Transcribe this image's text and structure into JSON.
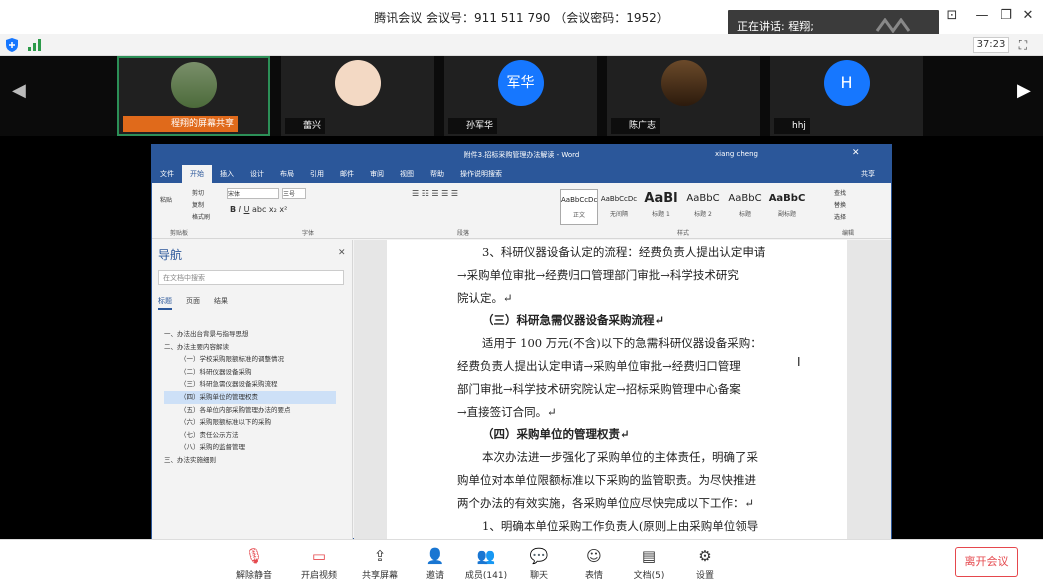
{
  "meeting": {
    "title": "腾讯会议 会议号：911 511 790 （会议密码：1952）",
    "timer": "37:23",
    "speaking": "正在讲话: 程翔;"
  },
  "participants": [
    {
      "name": "程翔的屏幕共享",
      "active": true
    },
    {
      "name": "蕾兴"
    },
    {
      "name": "孙军华",
      "initials": "军华",
      "color": "#1677ff"
    },
    {
      "name": "陈广志"
    },
    {
      "name": "hhj",
      "initials": "H",
      "color": "#1677ff"
    }
  ],
  "word": {
    "title": "附件3.招标采购管理办法解读 - Word",
    "user": "xiang cheng",
    "tabs": [
      "文件",
      "开始",
      "插入",
      "设计",
      "布局",
      "引用",
      "邮件",
      "审阅",
      "视图",
      "帮助",
      "操作说明搜索"
    ],
    "ribbon": {
      "paste": "粘贴",
      "cut": "剪切",
      "copy": "复制",
      "format_painter": "格式刷",
      "clipboard": "剪贴板",
      "font": "字体",
      "paragraph": "段落",
      "styles": "样式",
      "editing": "编辑",
      "font_name": "宋体",
      "font_size": "三号",
      "find": "查找",
      "replace": "替换",
      "select": "选择",
      "share": "共享"
    },
    "styles": [
      {
        "sample": "AaBbCcDc",
        "name": "正文"
      },
      {
        "sample": "AaBbCcDc",
        "name": "无间隔"
      },
      {
        "sample": "AaBl",
        "name": "标题 1"
      },
      {
        "sample": "AaBbC",
        "name": "标题 2"
      },
      {
        "sample": "AaBbC",
        "name": "标题"
      },
      {
        "sample": "AaBbC",
        "name": "副标题"
      }
    ],
    "nav": {
      "title": "导航",
      "search_placeholder": "在文档中搜索",
      "tabs": [
        "标题",
        "页面",
        "结果"
      ],
      "items": [
        {
          "text": "一、办法出台背景与指导思想",
          "level": 1
        },
        {
          "text": "二、办法主要内容解读",
          "level": 1
        },
        {
          "text": "（一）学校采购限额标准的调整情况",
          "level": 2
        },
        {
          "text": "（二）科研仪器设备采购",
          "level": 2
        },
        {
          "text": "（三）科研急需仪器设备采购流程",
          "level": 2
        },
        {
          "text": "（四）采购单位的管理权责",
          "level": 2,
          "selected": true
        },
        {
          "text": "（五）各单位内部采购管理办法的要点",
          "level": 2
        },
        {
          "text": "（六）采购限额标准以下的采购",
          "level": 2
        },
        {
          "text": "（七）责任公示方法",
          "level": 2
        },
        {
          "text": "（八）采购的监督管理",
          "level": 2
        },
        {
          "text": "三、办法实施细则",
          "level": 1
        }
      ]
    },
    "doc": [
      "3、科研仪器设备认定的流程：经费负责人提出认定申请",
      "→采购单位审批→经费归口管理部门审批→科学技术研究",
      "院认定。↵",
      "（三）科研急需仪器设备采购流程↵",
      "适用于 100 万元(不含)以下的急需科研仪器设备采购：",
      "经费负责人提出认定申请→采购单位审批→经费归口管理",
      "部门审批→科学技术研究院认定→招标采购管理中心备案",
      "→直接签订合同。↵",
      "（四）采购单位的管理权责↵",
      "本次办法进一步强化了采购单位的主体责任，明确了采",
      "购单位对本单位限额标准以下采购的监管职责。为尽快推进",
      "两个办法的有效实施，各采购单位应尽快完成以下工作：↵",
      "1、明确本单位采购工作负责人(原则上由采购单位领导"
    ]
  },
  "toolbar": [
    {
      "label": "解除静音",
      "icon": "mic-off-icon"
    },
    {
      "label": "开启视频",
      "icon": "video-off-icon"
    },
    {
      "label": "共享屏幕",
      "icon": "share-screen-icon"
    },
    {
      "label": "邀请",
      "icon": "invite-icon"
    },
    {
      "label": "成员(141)",
      "icon": "members-icon"
    },
    {
      "label": "聊天",
      "icon": "chat-icon"
    },
    {
      "label": "表情",
      "icon": "emoji-icon"
    },
    {
      "label": "文档(5)",
      "icon": "document-icon"
    },
    {
      "label": "设置",
      "icon": "settings-icon"
    }
  ],
  "leave": "离开会议"
}
